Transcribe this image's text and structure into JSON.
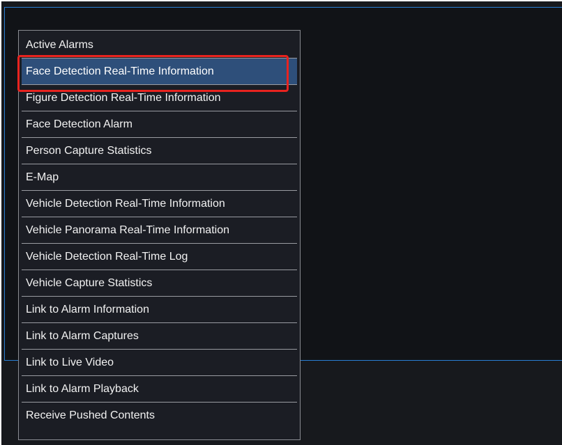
{
  "context_menu": {
    "items": [
      {
        "label": "Active Alarms",
        "selected": false
      },
      {
        "label": "Face Detection Real-Time Information",
        "selected": true
      },
      {
        "label": "Figure Detection Real-Time Information",
        "selected": false
      },
      {
        "label": "Face Detection Alarm",
        "selected": false
      },
      {
        "label": "Person Capture Statistics",
        "selected": false
      },
      {
        "label": "E-Map",
        "selected": false
      },
      {
        "label": "Vehicle Detection Real-Time Information",
        "selected": false
      },
      {
        "label": "Vehicle Panorama Real-Time Information",
        "selected": false
      },
      {
        "label": "Vehicle Detection Real-Time Log",
        "selected": false
      },
      {
        "label": "Vehicle Capture Statistics",
        "selected": false
      },
      {
        "label": "Link to Alarm Information",
        "selected": false
      },
      {
        "label": "Link to Alarm Captures",
        "selected": false
      },
      {
        "label": "Link to Live Video",
        "selected": false
      },
      {
        "label": "Link to Alarm Playback",
        "selected": false
      },
      {
        "label": "Receive Pushed Contents",
        "selected": false
      }
    ]
  },
  "colors": {
    "background": "#17191d",
    "panel_border": "#2a7fd4",
    "menu_background": "#1b1d24",
    "selected_item": "#2e4f7a",
    "highlight_annotation": "#e8231f"
  }
}
